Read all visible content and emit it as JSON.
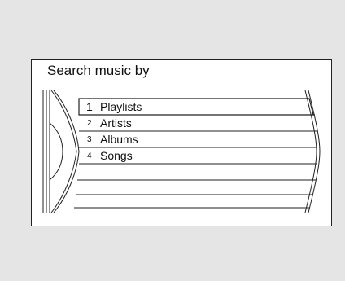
{
  "header": {
    "title": "Search music by"
  },
  "menu": {
    "items": [
      {
        "number": "1",
        "label": "Playlists",
        "selected": true
      },
      {
        "number": "2",
        "label": "Artists",
        "selected": false
      },
      {
        "number": "3",
        "label": "Albums",
        "selected": false
      },
      {
        "number": "4",
        "label": "Songs",
        "selected": false
      }
    ]
  },
  "colors": {
    "background": "#e5e5e6",
    "screen": "#ffffff",
    "lines": "#222222"
  }
}
